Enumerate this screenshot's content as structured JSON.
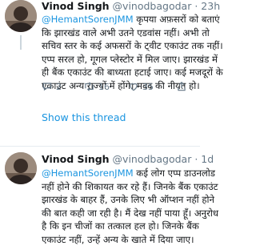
{
  "tweets": [
    {
      "author": "Vinod Singh",
      "handle": "@vinodbagodar",
      "time": "23h",
      "mention": "@HemantSorenJMM",
      "lines": [
        " कृपया अफ़सरों को बताएं",
        "कि झारखंड वाले अभी उतने एडवांस नहीं। अभी तो",
        "सचिव स्तर के कई अफसरों के ट्वीट एकाउंट तक नहीं।",
        "एप्प सरल हो, गूगल प्लेस्टोर में मिल जाए। झारखंड में",
        "ही बैंक एकाउंट की बाध्यता हटाई जाए। कई मजदूरों के",
        "एकाउंट अन्य राज्यों में होंगे। मदद की नीयत हो।"
      ],
      "reply_count": "2",
      "retweet_count": "16",
      "like_count": "35",
      "show_thread": "Show this thread"
    },
    {
      "author": "Vinod Singh",
      "handle": "@vinodbagodar",
      "time": "1d",
      "mention": "@HemantSorenJMM",
      "lines": [
        " कई लोग एप्प डाउनलोड",
        "नहीं होने की शिकायत कर रहे हैं। जिनके बैंक एकाउंट",
        "झारखंड के बाहर हैं, उनके लिए भी ऑप्शन नहीं होने",
        "की बात कही जा रही है। मैं देख नहीं पाया हूँ। अनुरोध",
        "है कि इन चीजों का तत्काल हल हो। जिनके बैंक",
        "एकाउंट नहीं, उन्हें अन्य के खाते में दिया जाए।"
      ]
    }
  ],
  "colors": {
    "accent": "#1b95e0",
    "muted": "#657786",
    "divider": "#e6ecf0"
  }
}
